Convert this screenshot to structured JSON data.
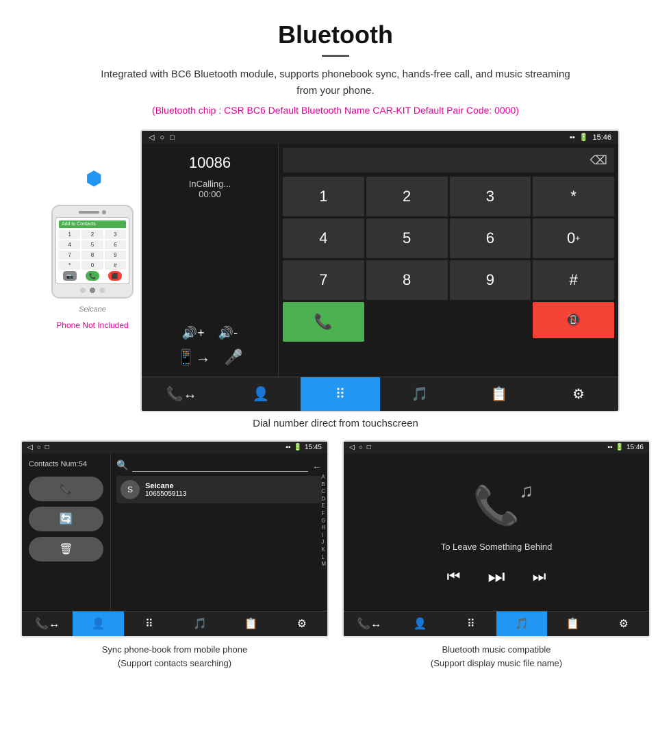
{
  "header": {
    "title": "Bluetooth",
    "description": "Integrated with BC6 Bluetooth module, supports phonebook sync, hands-free call, and music streaming from your phone.",
    "info": "(Bluetooth chip : CSR BC6    Default Bluetooth Name CAR-KIT    Default Pair Code: 0000)"
  },
  "main_screen": {
    "status_bar": {
      "time": "15:46",
      "icons_left": [
        "back",
        "circle",
        "square"
      ],
      "icons_right": [
        "phone",
        "pin",
        "wifi",
        "battery"
      ]
    },
    "call": {
      "number": "10086",
      "status": "InCalling...",
      "time": "00:00"
    },
    "dialpad": {
      "keys": [
        "1",
        "2",
        "3",
        "*",
        "4",
        "5",
        "6",
        "0+",
        "7",
        "8",
        "9",
        "#"
      ]
    },
    "bottom_nav": {
      "items": [
        "phone-transfer",
        "contacts",
        "dialpad",
        "bluetooth-music",
        "phone-book",
        "settings"
      ]
    }
  },
  "main_caption": "Dial number direct from touchscreen",
  "phone_not_included": "Phone Not Included",
  "phonebook_screen": {
    "contacts_num": "Contacts Num:54",
    "contact_name": "Seicane",
    "contact_number": "10655059113",
    "search_placeholder": "Search",
    "alpha_letters": [
      "A",
      "B",
      "C",
      "D",
      "E",
      "F",
      "G",
      "H",
      "I",
      "J",
      "K",
      "L",
      "M"
    ],
    "status_bar_time": "15:45",
    "caption_line1": "Sync phone-book from mobile phone",
    "caption_line2": "(Support contacts searching)"
  },
  "music_screen": {
    "song_title": "To Leave Something Behind",
    "status_bar_time": "15:46",
    "caption_line1": "Bluetooth music compatible",
    "caption_line2": "(Support display music file name)"
  }
}
